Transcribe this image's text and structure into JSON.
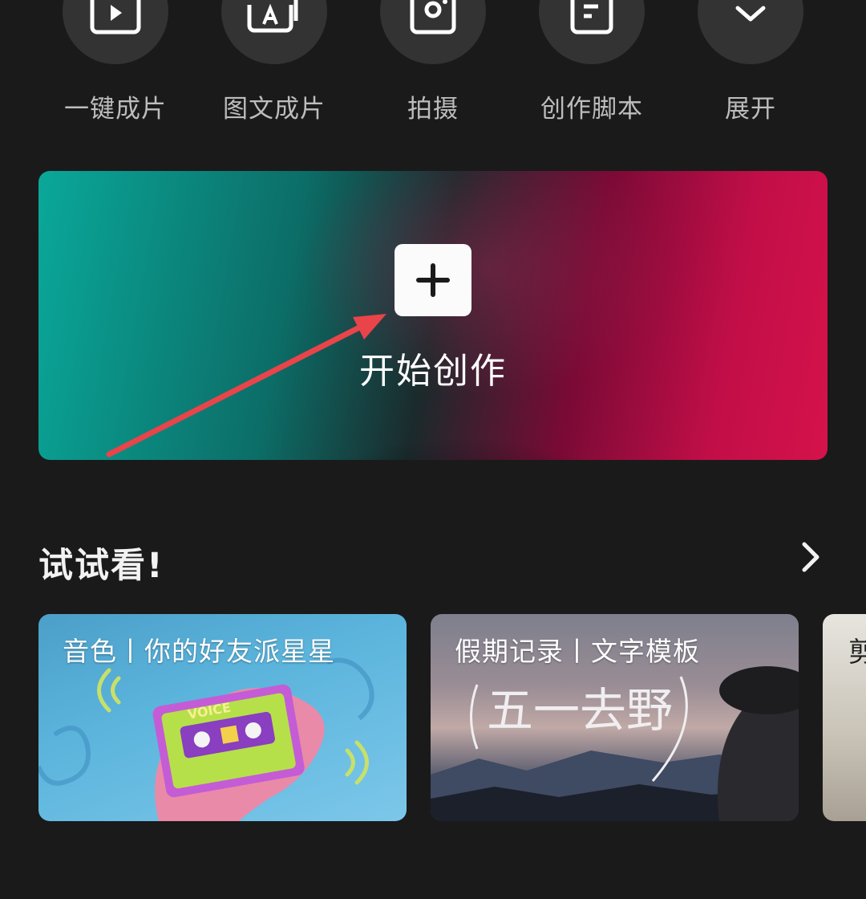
{
  "tools": [
    {
      "label": "一键成片",
      "icon": "play-icon"
    },
    {
      "label": "图文成片",
      "icon": "text-image-icon"
    },
    {
      "label": "拍摄",
      "icon": "camera-icon"
    },
    {
      "label": "创作脚本",
      "icon": "script-icon"
    },
    {
      "label": "展开",
      "icon": "chevron-down-icon"
    }
  ],
  "banner": {
    "title": "开始创作"
  },
  "section": {
    "title": "试试看!"
  },
  "cards": [
    {
      "title": "音色丨你的好友派星星",
      "art_text": "VOICE"
    },
    {
      "title": "假期记录丨文字模板",
      "art_text": "五一去野"
    },
    {
      "title": "剪"
    }
  ],
  "colors": {
    "background": "#1a1a1a",
    "tool_circle": "#333333",
    "annotation_arrow": "#e8444a"
  }
}
